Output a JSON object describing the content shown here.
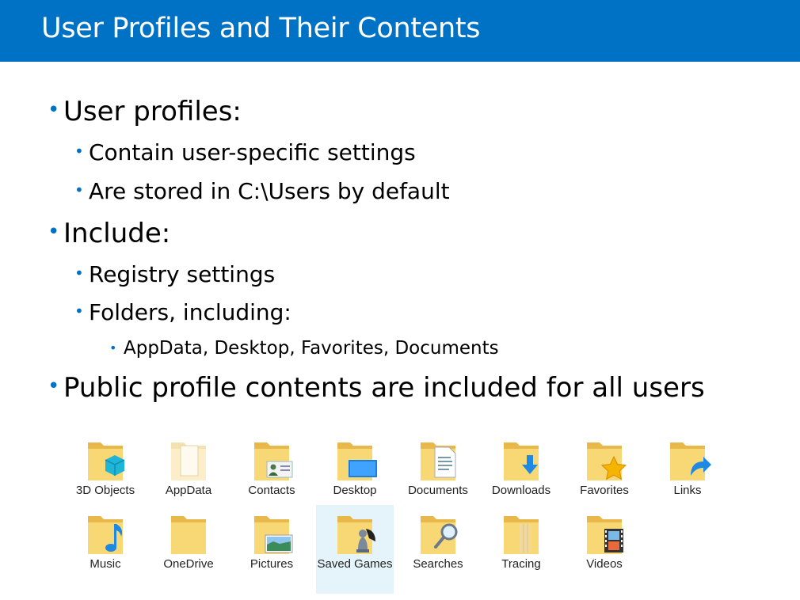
{
  "slide": {
    "title": "User Profiles and Their Contents",
    "accent_color": "#0072c6"
  },
  "bullets": [
    {
      "level": 1,
      "text": "User profiles:"
    },
    {
      "level": 2,
      "text": "Contain user-specific settings"
    },
    {
      "level": 2,
      "text": "Are stored in C:\\Users by default"
    },
    {
      "level": 1,
      "text": "Include:"
    },
    {
      "level": 2,
      "text": "Registry settings"
    },
    {
      "level": 2,
      "text": "Folders, including:"
    },
    {
      "level": 3,
      "text": "AppData, Desktop, Favorites, Documents"
    },
    {
      "level": 1,
      "text": "Public profile contents are included for all users"
    }
  ],
  "folders": [
    {
      "label": "3D Objects",
      "icon": "3d-objects-folder-icon"
    },
    {
      "label": "AppData",
      "icon": "appdata-folder-icon"
    },
    {
      "label": "Contacts",
      "icon": "contacts-folder-icon"
    },
    {
      "label": "Desktop",
      "icon": "desktop-folder-icon"
    },
    {
      "label": "Documents",
      "icon": "documents-folder-icon"
    },
    {
      "label": "Downloads",
      "icon": "downloads-folder-icon"
    },
    {
      "label": "Favorites",
      "icon": "favorites-folder-icon"
    },
    {
      "label": "Links",
      "icon": "links-folder-icon"
    },
    {
      "label": "Music",
      "icon": "music-folder-icon"
    },
    {
      "label": "OneDrive",
      "icon": "onedrive-folder-icon"
    },
    {
      "label": "Pictures",
      "icon": "pictures-folder-icon"
    },
    {
      "label": "Saved Games",
      "icon": "saved-games-folder-icon",
      "selected": true
    },
    {
      "label": "Searches",
      "icon": "searches-folder-icon"
    },
    {
      "label": "Tracing",
      "icon": "tracing-folder-icon"
    },
    {
      "label": "Videos",
      "icon": "videos-folder-icon"
    }
  ]
}
